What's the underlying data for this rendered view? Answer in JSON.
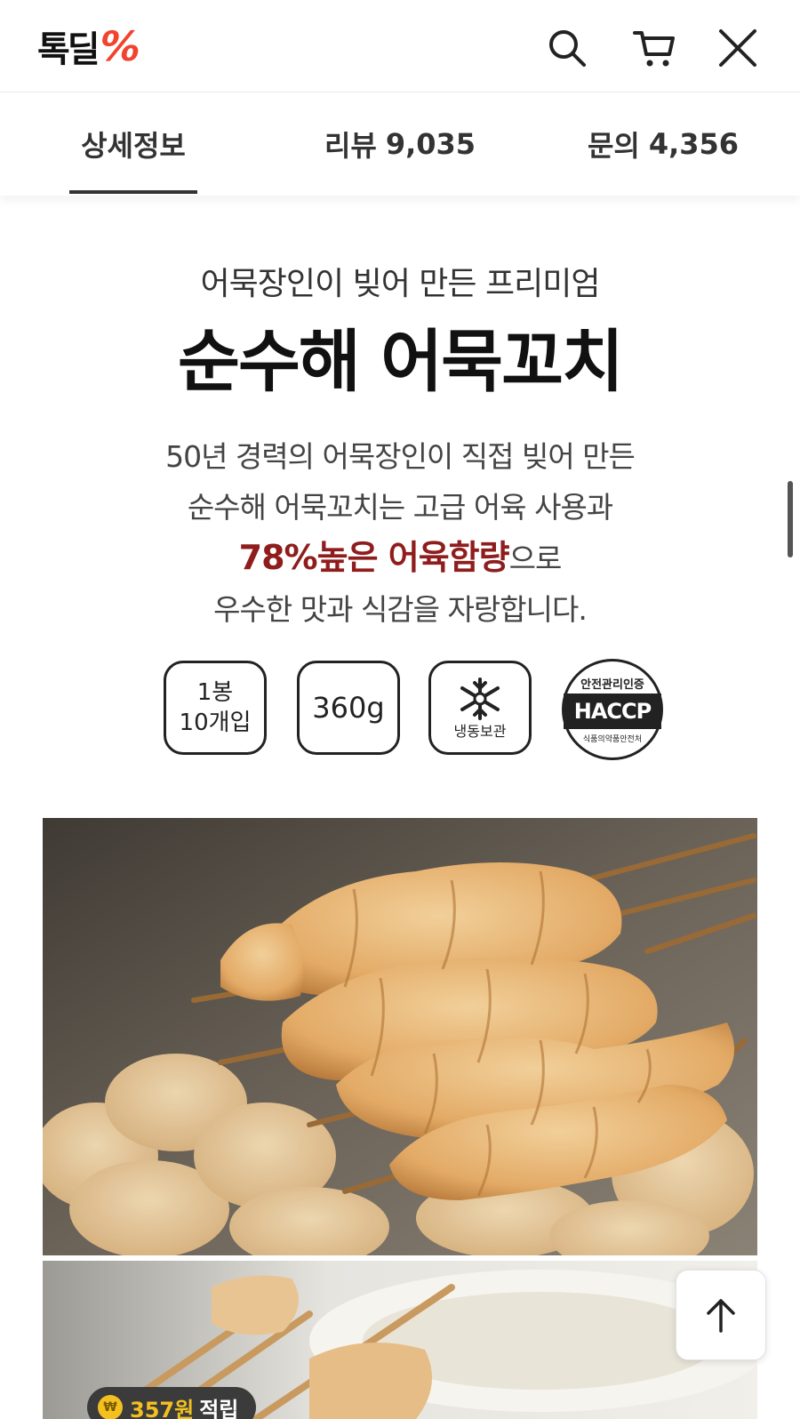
{
  "header": {
    "logo_text": "톡딜",
    "logo_mark": "%",
    "icons": [
      "search-icon",
      "cart-icon",
      "close-icon"
    ]
  },
  "tabs": [
    {
      "label": "상세정보",
      "count": "",
      "active": true
    },
    {
      "label": "리뷰",
      "count": "9,035",
      "active": false
    },
    {
      "label": "문의",
      "count": "4,356",
      "active": false
    }
  ],
  "product": {
    "subtitle": "어묵장인이 빚어 만든 프리미엄",
    "title": "순수해 어묵꼬치",
    "desc_line1": "50년 경력의 어묵장인이 직접 빚어 만든",
    "desc_line2": "순수해 어묵꼬치는 고급 어육 사용과",
    "desc_highlight": "78%높은 어육함량",
    "desc_line3_rest": "으로",
    "desc_line4": "우수한 맛과 식감을 자랑합니다."
  },
  "badges": {
    "pack_line1": "1봉",
    "pack_line2": "10개입",
    "weight": "360g",
    "frozen_label": "냉동보관",
    "haccp_top": "안전관리인증",
    "haccp_mark": "HACCP",
    "haccp_bottom": "식품의약품안전처"
  },
  "floating": {
    "points_amount": "357원",
    "points_label": "적립",
    "coin_symbol": "₩"
  },
  "colors": {
    "brand_accent": "#f2432f",
    "highlight_text": "#8f1d1d",
    "coin": "#f3c020"
  }
}
